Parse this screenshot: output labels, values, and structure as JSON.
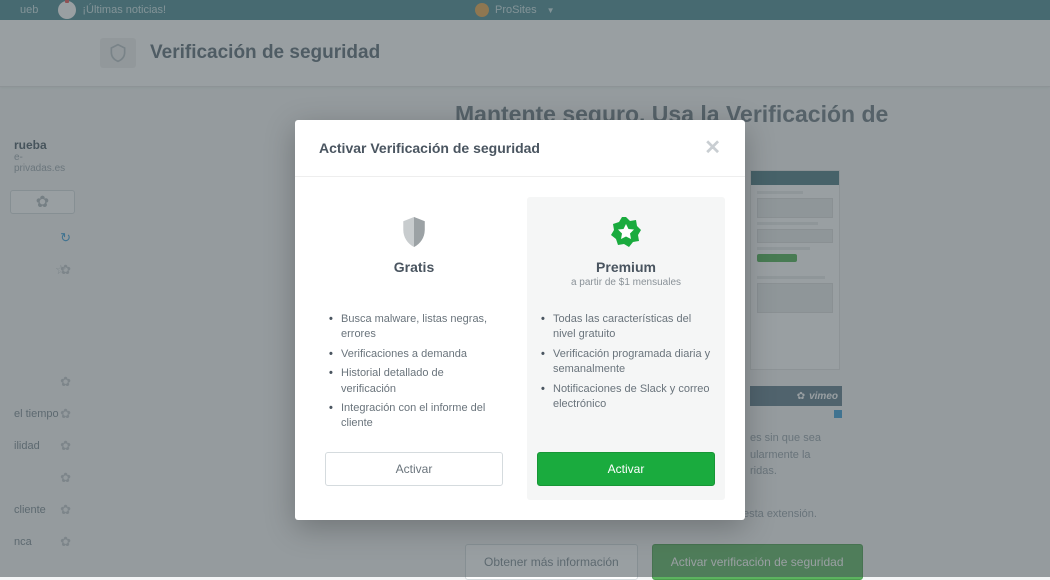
{
  "topbar": {
    "item1": "ueb",
    "news": "¡Últimas noticias!",
    "brand_label": "ProSites"
  },
  "header": {
    "title": "Verificación de seguridad"
  },
  "sidebar": {
    "title": "rueba",
    "sub": "e-privadas.es",
    "items": [
      {
        "label": ""
      },
      {
        "label": "el tiempo"
      },
      {
        "label": "ilidad"
      },
      {
        "label": ""
      },
      {
        "label": "cliente"
      },
      {
        "label": "nca"
      }
    ]
  },
  "content": {
    "heading": "Mantente seguro. Usa la Verificación de",
    "desc_l1": "es sin que sea",
    "desc_l2": "ularmente la",
    "desc_l3": "ridas.",
    "avail": "Están disponibles las versiones gratuita y premium de esta extensión.",
    "btn_info": "Obtener más información",
    "btn_activate": "Activar verificación de seguridad",
    "vimeo": "vimeo"
  },
  "modal": {
    "title": "Activar Verificación de seguridad",
    "free": {
      "name": "Gratis",
      "features": [
        "Busca malware, listas negras, errores",
        "Verificaciones a demanda",
        "Historial detallado de verificación",
        "Integración con el informe del cliente"
      ],
      "cta": "Activar"
    },
    "premium": {
      "name": "Premium",
      "sub": "a partir de $1 mensuales",
      "features": [
        "Todas las características del nivel gratuito",
        "Verificación programada diaria y semanalmente",
        "Notificaciones de Slack y correo electrónico"
      ],
      "cta": "Activar"
    }
  }
}
